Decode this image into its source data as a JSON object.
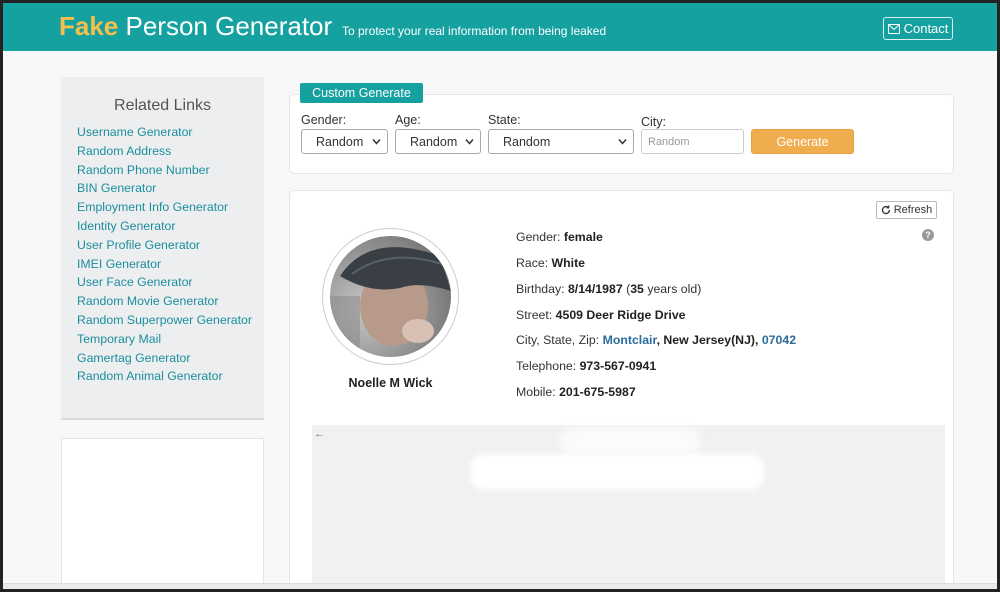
{
  "header": {
    "brand_fake": "Fake",
    "brand_rest": "Person Generator",
    "tagline": "To protect your real information from being leaked",
    "contact_label": "Contact",
    "accent_color": "#16a1a1",
    "brand_color": "#f5c04a"
  },
  "sidebar": {
    "title": "Related Links",
    "links": [
      "Username Generator",
      "Random Address",
      "Random Phone Number",
      "BIN Generator",
      "Employment Info Generator",
      "Identity Generator",
      "User Profile Generator",
      "IMEI Generator",
      "User Face Generator",
      "Random Movie Generator",
      "Random Superpower Generator",
      "Temporary Mail",
      "Gamertag Generator",
      "Random Animal Generator"
    ]
  },
  "form": {
    "tag_label": "Custom Generate",
    "gender_label": "Gender:",
    "gender_value": "Random",
    "age_label": "Age:",
    "age_value": "Random",
    "state_label": "State:",
    "state_value": "Random",
    "city_label": "City:",
    "city_placeholder": "Random",
    "generate_label": "Generate",
    "generate_color": "#f0ad4e"
  },
  "result": {
    "refresh_label": "Refresh",
    "help_symbol": "?",
    "name": "Noelle M Wick",
    "gender_label": "Gender:",
    "gender": "female",
    "race_label": "Race:",
    "race": "White",
    "birthday_label": "Birthday:",
    "birthday": "8/14/1987",
    "age_open": "(",
    "age_years": "35",
    "age_suffix": "years old)",
    "street_label": "Street:",
    "street": "4509 Deer Ridge Drive",
    "csz_label": "City, State, Zip:",
    "city": "Montclair",
    "state_sep": ",",
    "state": "New Jersey(NJ)",
    "zip_sep": ",",
    "zip": "07042",
    "telephone_label": "Telephone:",
    "telephone": "973-567-0941",
    "mobile_label": "Mobile:",
    "mobile": "201-675-5987",
    "map_back_icon": "←"
  }
}
